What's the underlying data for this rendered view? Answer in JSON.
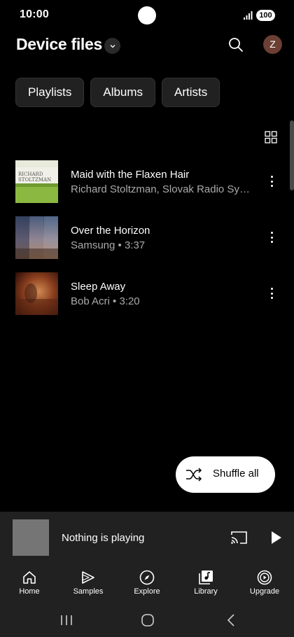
{
  "status_bar": {
    "time": "10:00",
    "battery": "100",
    "icons": [
      "signal-icon",
      "battery-icon"
    ]
  },
  "header": {
    "title": "Device files",
    "icons": [
      "chevron-down-icon",
      "search-icon"
    ],
    "avatar_letter": "Z"
  },
  "chips": [
    {
      "label": "Playlists"
    },
    {
      "label": "Albums"
    },
    {
      "label": "Artists"
    }
  ],
  "songs": [
    {
      "title": "Maid with the Flaxen Hair",
      "subtitle": "Richard Stoltzman, Slovak Radio Sym...",
      "art_text": [
        "RICHARD",
        "STOLTZMAN"
      ]
    },
    {
      "title": "Over the Horizon",
      "subtitle": "Samsung • 3:37"
    },
    {
      "title": "Sleep Away",
      "subtitle": "Bob Acri • 3:20"
    }
  ],
  "shuffle": {
    "label": "Shuffle all",
    "icon": "shuffle-icon"
  },
  "mini_player": {
    "title": "Nothing is playing",
    "icons": [
      "cast-icon",
      "play-icon"
    ]
  },
  "bottom_nav": [
    {
      "label": "Home",
      "icon": "home-icon"
    },
    {
      "label": "Samples",
      "icon": "samples-icon"
    },
    {
      "label": "Explore",
      "icon": "compass-icon"
    },
    {
      "label": "Library",
      "icon": "library-icon"
    },
    {
      "label": "Upgrade",
      "icon": "upgrade-icon"
    }
  ],
  "system_nav": [
    "recents-icon",
    "home-circle-icon",
    "back-icon"
  ],
  "colors": {
    "background": "#000000",
    "surface": "#212121",
    "chip": "#212121",
    "secondary_text": "#aaaaaa",
    "avatar": "#6b3f33"
  }
}
